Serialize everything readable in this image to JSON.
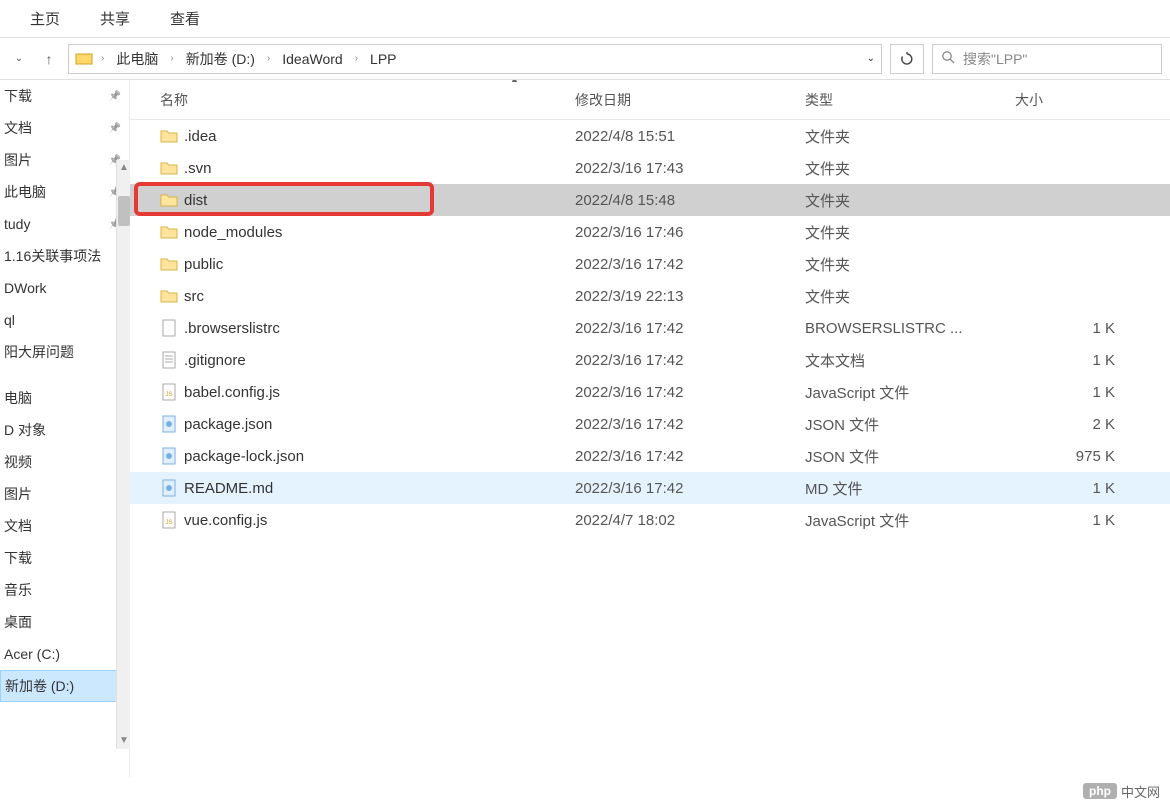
{
  "topMenu": {
    "items": [
      "主页",
      "共享",
      "查看"
    ]
  },
  "breadcrumb": {
    "items": [
      "此电脑",
      "新加卷 (D:)",
      "IdeaWord",
      "LPP"
    ]
  },
  "refreshLabel": "↻",
  "search": {
    "placeholder": "搜索\"LPP\""
  },
  "sidebar": {
    "items": [
      {
        "label": "下载",
        "pinned": true
      },
      {
        "label": "文档",
        "pinned": true
      },
      {
        "label": "图片",
        "pinned": true
      },
      {
        "label": "此电脑",
        "pinned": true
      },
      {
        "label": "tudy",
        "pinned": true
      },
      {
        "label": "1.16关联事项法",
        "pinned": false
      },
      {
        "label": "DWork",
        "pinned": false
      },
      {
        "label": "ql",
        "pinned": false
      },
      {
        "label": "阳大屏问题",
        "pinned": false
      },
      {
        "label": "",
        "pinned": false,
        "spacer": true
      },
      {
        "label": "电脑",
        "pinned": false
      },
      {
        "label": "D 对象",
        "pinned": false
      },
      {
        "label": "视频",
        "pinned": false
      },
      {
        "label": "图片",
        "pinned": false
      },
      {
        "label": "文档",
        "pinned": false
      },
      {
        "label": "下载",
        "pinned": false
      },
      {
        "label": "音乐",
        "pinned": false
      },
      {
        "label": "桌面",
        "pinned": false
      },
      {
        "label": "Acer (C:)",
        "pinned": false
      },
      {
        "label": "新加卷 (D:)",
        "pinned": false,
        "selected": true
      }
    ]
  },
  "columns": {
    "name": "名称",
    "date": "修改日期",
    "type": "类型",
    "size": "大小"
  },
  "files": [
    {
      "icon": "folder",
      "name": ".idea",
      "date": "2022/4/8 15:51",
      "type": "文件夹",
      "size": ""
    },
    {
      "icon": "folder",
      "name": ".svn",
      "date": "2022/3/16 17:43",
      "type": "文件夹",
      "size": ""
    },
    {
      "icon": "folder",
      "name": "dist",
      "date": "2022/4/8 15:48",
      "type": "文件夹",
      "size": "",
      "selected": true,
      "highlighted": true
    },
    {
      "icon": "folder",
      "name": "node_modules",
      "date": "2022/3/16 17:46",
      "type": "文件夹",
      "size": ""
    },
    {
      "icon": "folder",
      "name": "public",
      "date": "2022/3/16 17:42",
      "type": "文件夹",
      "size": ""
    },
    {
      "icon": "folder",
      "name": "src",
      "date": "2022/3/19 22:13",
      "type": "文件夹",
      "size": ""
    },
    {
      "icon": "file",
      "name": ".browserslistrc",
      "date": "2022/3/16 17:42",
      "type": "BROWSERSLISTRC ...",
      "size": "1 K"
    },
    {
      "icon": "text",
      "name": ".gitignore",
      "date": "2022/3/16 17:42",
      "type": "文本文档",
      "size": "1 K"
    },
    {
      "icon": "js",
      "name": "babel.config.js",
      "date": "2022/3/16 17:42",
      "type": "JavaScript 文件",
      "size": "1 K"
    },
    {
      "icon": "json",
      "name": "package.json",
      "date": "2022/3/16 17:42",
      "type": "JSON 文件",
      "size": "2 K"
    },
    {
      "icon": "json",
      "name": "package-lock.json",
      "date": "2022/3/16 17:42",
      "type": "JSON 文件",
      "size": "975 K"
    },
    {
      "icon": "md",
      "name": "README.md",
      "date": "2022/3/16 17:42",
      "type": "MD 文件",
      "size": "1 K",
      "hover": true
    },
    {
      "icon": "js",
      "name": "vue.config.js",
      "date": "2022/4/7 18:02",
      "type": "JavaScript 文件",
      "size": "1 K"
    }
  ],
  "footer": {
    "logo": "php",
    "text": "中文网"
  }
}
